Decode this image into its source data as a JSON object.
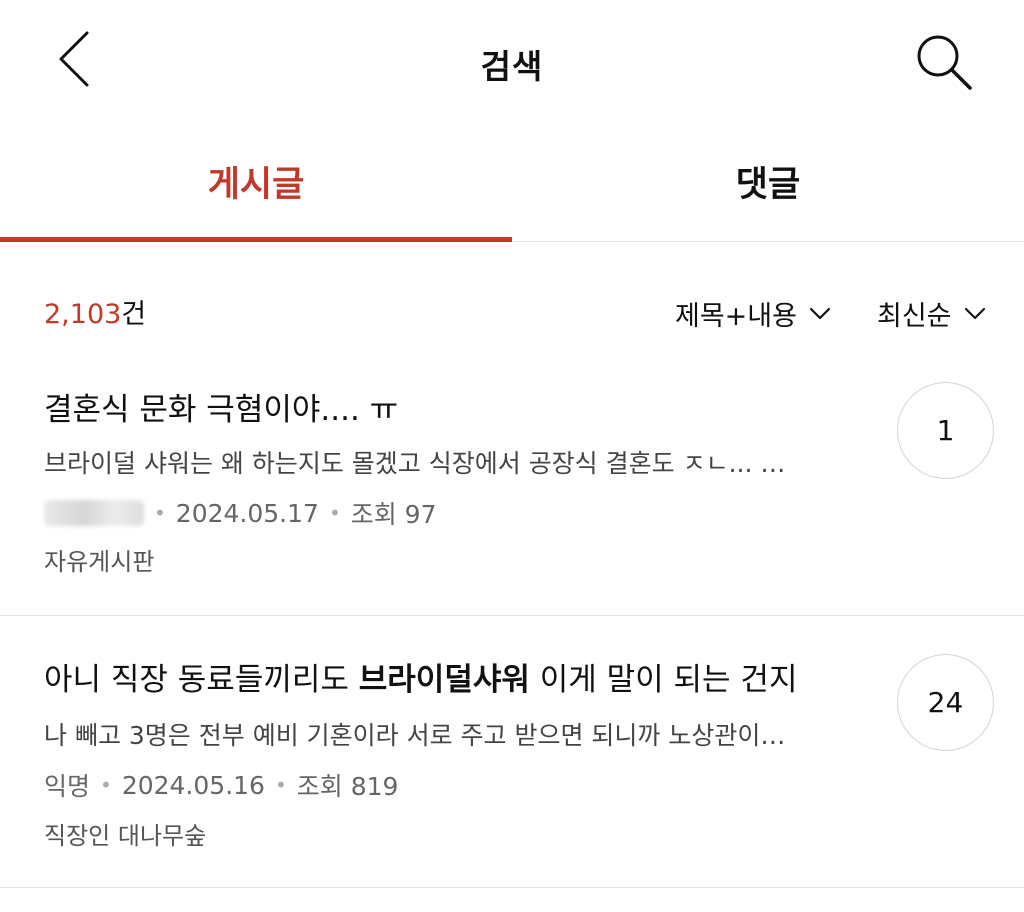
{
  "header": {
    "title": "검색",
    "back_icon": "chevron-left-icon",
    "search_icon": "search-icon"
  },
  "tabs": [
    {
      "label": "게시글",
      "active": true
    },
    {
      "label": "댓글",
      "active": false
    }
  ],
  "filter": {
    "count": "2,103",
    "count_unit": "건",
    "scope_label": "제목+내용",
    "sort_label": "최신순"
  },
  "posts": [
    {
      "title_before": "결혼식 문화 극혐이야.... ㅠ",
      "title_highlight": "",
      "title_after": "",
      "preview": "브라이덜 샤워는 왜 하는지도 몰겠고 식장에서 공장식 결혼도 ㅈㄴ... …",
      "author": "",
      "date": "2024.05.17",
      "views": "조회 97",
      "board": "자유게시판",
      "comments": "1"
    },
    {
      "title_before": "아니 직장 동료들끼리도 ",
      "title_highlight": "브라이덜샤워",
      "title_after": " 이게 말이 되는 건지",
      "preview": "나 빼고 3명은 전부 예비 기혼이라 서로 주고 받으면 되니까 노상관이…",
      "author": "익명",
      "date": "2024.05.16",
      "views": "조회 819",
      "board": "직장인 대나무숲",
      "comments": "24"
    }
  ],
  "colors": {
    "accent": "#c0392b",
    "text": "#111111",
    "muted": "#666666",
    "divider": "#e3e3e3"
  }
}
